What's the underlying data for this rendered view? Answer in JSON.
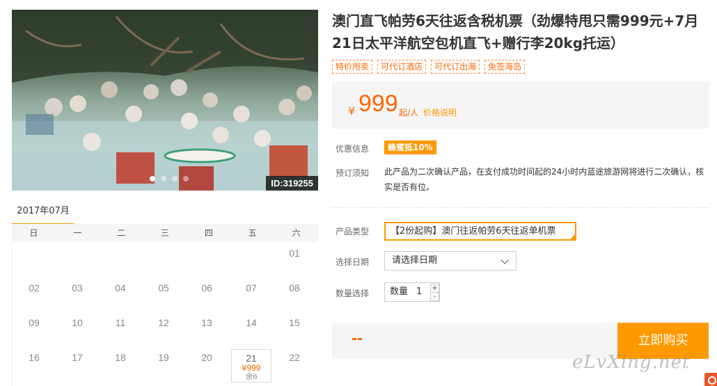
{
  "photo": {
    "id_label": "ID:319255",
    "slide_count": 4,
    "active_slide": 0
  },
  "calendar": {
    "month": "2017年07月",
    "weekdays": [
      "日",
      "一",
      "二",
      "三",
      "四",
      "五",
      "六"
    ],
    "days": [
      {
        "d": "01",
        "col": 6,
        "row": 0
      },
      {
        "d": "02",
        "col": 0,
        "row": 1
      },
      {
        "d": "03",
        "col": 1,
        "row": 1
      },
      {
        "d": "04",
        "col": 2,
        "row": 1
      },
      {
        "d": "05",
        "col": 3,
        "row": 1
      },
      {
        "d": "06",
        "col": 4,
        "row": 1
      },
      {
        "d": "07",
        "col": 5,
        "row": 1
      },
      {
        "d": "08",
        "col": 6,
        "row": 1
      },
      {
        "d": "09",
        "col": 0,
        "row": 2
      },
      {
        "d": "10",
        "col": 1,
        "row": 2
      },
      {
        "d": "11",
        "col": 2,
        "row": 2
      },
      {
        "d": "12",
        "col": 3,
        "row": 2
      },
      {
        "d": "13",
        "col": 4,
        "row": 2
      },
      {
        "d": "14",
        "col": 5,
        "row": 2
      },
      {
        "d": "15",
        "col": 6,
        "row": 2
      },
      {
        "d": "16",
        "col": 0,
        "row": 3
      },
      {
        "d": "17",
        "col": 1,
        "row": 3
      },
      {
        "d": "18",
        "col": 2,
        "row": 3
      },
      {
        "d": "19",
        "col": 3,
        "row": 3
      },
      {
        "d": "20",
        "col": 4,
        "row": 3
      },
      {
        "d": "21",
        "col": 5,
        "row": 3,
        "price": "¥999",
        "stock": "余6"
      },
      {
        "d": "22",
        "col": 6,
        "row": 3
      }
    ]
  },
  "product": {
    "title": "澳门直飞帕劳6天往返含税机票（劲爆特甩只需999元+7月21日太平洋航空包机直飞+赠行李20kg托运）",
    "tags": [
      "特价甩卖",
      "可代订酒店",
      "可代订出海",
      "免签海岛"
    ],
    "price": {
      "currency": "¥",
      "amount": "999",
      "unit": "起/人",
      "desc_link": "价格说明"
    },
    "discount": {
      "label": "优惠信息",
      "badge": "蜂蜜抵10%"
    },
    "notice": {
      "label": "预订须知",
      "text": "此产品为二次确认产品，在支付成功时间起的24小时内蓝途旅游网将进行二次确认，核实是否有位。"
    }
  },
  "booking": {
    "type_label": "产品类型",
    "type_value": "【2份起购】澳门往返帕劳6天往返单机票",
    "date_label": "选择日期",
    "date_placeholder": "请选择日期",
    "qty_label": "数量选择",
    "qty_inner_label": "数量",
    "qty_value": "1",
    "qty_plus": "+",
    "qty_minus": "-",
    "total": "--",
    "buy_label": "立即购买"
  },
  "watermark": "eLvXing.net",
  "colors": {
    "accent": "#ff9900",
    "price": "#ff6600"
  }
}
